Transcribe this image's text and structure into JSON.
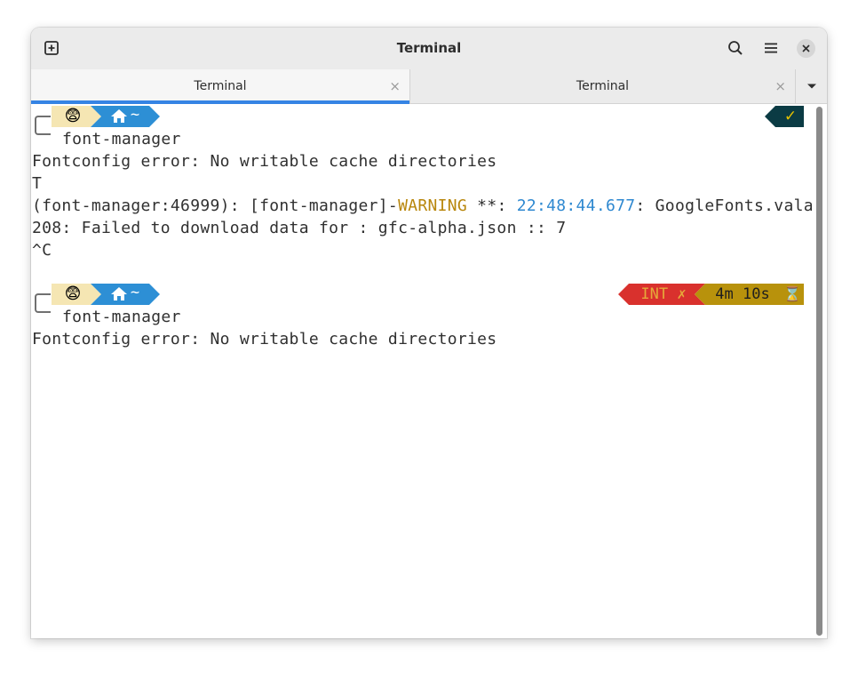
{
  "window": {
    "title": "Terminal"
  },
  "tabs": [
    {
      "label": "Terminal",
      "close": "×",
      "active": true
    },
    {
      "label": "Terminal",
      "close": "×",
      "active": false
    }
  ],
  "prompts": [
    {
      "emoji": "😨",
      "path": "~",
      "command": "font-manager",
      "right_status": "✓"
    },
    {
      "emoji": "😨",
      "path": "~",
      "command": "font-manager",
      "right_status": "INT ✗",
      "duration": "4m 10s",
      "duration_icon": "⌛"
    }
  ],
  "output": {
    "line1": "Fontconfig error: No writable cache directories",
    "line2": "T",
    "warn_prefix": "(font-manager:46999): [font-manager]-",
    "warn_level": "WARNING",
    "warn_stars": " **: ",
    "warn_time": "22:48:44.677",
    "warn_tail": ": GoogleFonts.vala:",
    "line4": "208: Failed to download data for : gfc-alpha.json :: 7",
    "line5": "^C",
    "line6": "Fontconfig error: No writable cache directories"
  },
  "colors": {
    "accent": "#3584e4",
    "emoji_segment": "#f5e6b3",
    "path_segment": "#2d8fd5",
    "ok_segment": "#0b3b44",
    "ok_check": "#e6c200",
    "int_segment": "#d9312d",
    "int_text": "#e6a93a",
    "duration_segment": "#b8920c"
  }
}
